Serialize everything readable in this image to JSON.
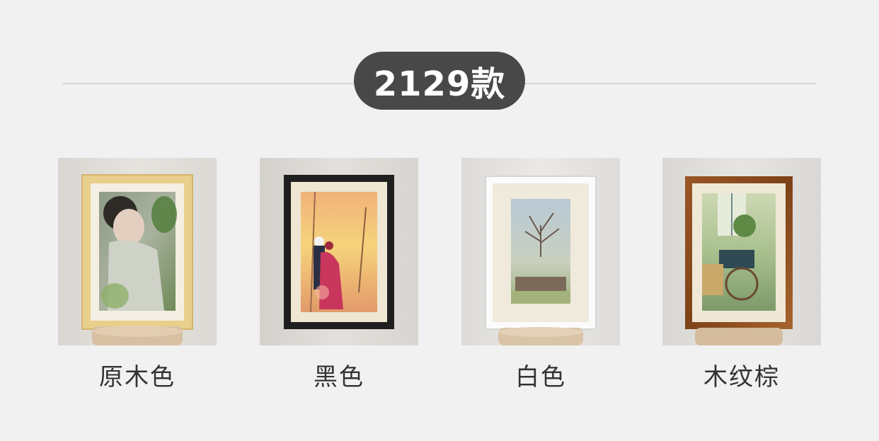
{
  "header": {
    "title": "2129款"
  },
  "frames": [
    {
      "label": "原木色",
      "frame_color": "#e8cf8c"
    },
    {
      "label": "黑色",
      "frame_color": "#1e1e1e"
    },
    {
      "label": "白色",
      "frame_color": "#fbfbfb"
    },
    {
      "label": "木纹棕",
      "frame_color": "#8a4a1c"
    }
  ]
}
